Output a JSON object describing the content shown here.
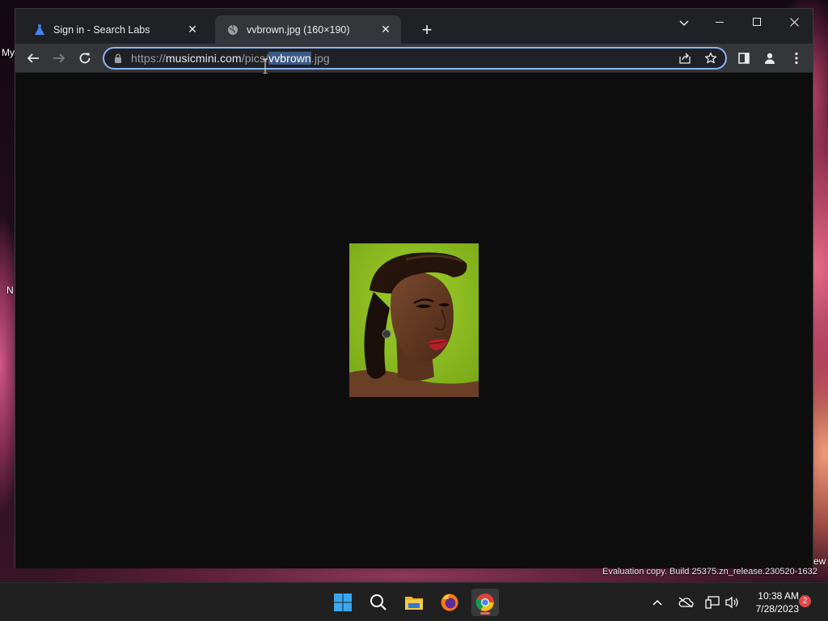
{
  "desktop": {
    "icon_label_partial": "My",
    "icon_label_partial_2": "N",
    "icon_label_partial_3": "ew"
  },
  "browser": {
    "tabs": [
      {
        "title": "Sign in - Search Labs",
        "icon": "flask-icon",
        "active": false
      },
      {
        "title": "vvbrown.jpg (160×190)",
        "icon": "globe-icon",
        "active": true
      }
    ],
    "new_tab_label": "+",
    "url": {
      "scheme": "https://",
      "host": "musicmini.com",
      "path_before": "/pics/",
      "selected": "vvbrown",
      "path_after": ".jpg"
    }
  },
  "watermark": "Evaluation copy. Build 25375.zn_release.230520-1632",
  "taskbar": {
    "clock_time": "10:38 AM",
    "clock_date": "7/28/2023",
    "notification_count": "2"
  },
  "colors": {
    "accent": "#8ab4f8",
    "tab_active": "#35363a",
    "tabstrip": "#202124",
    "page_bg": "#0e0e0e",
    "photo_bg": "#8dc21f"
  }
}
